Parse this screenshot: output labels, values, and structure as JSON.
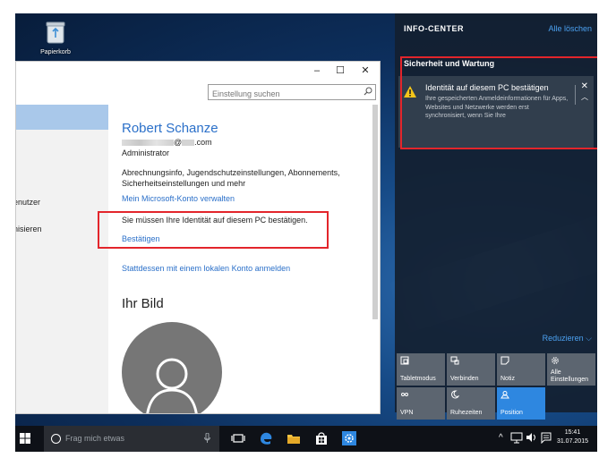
{
  "desktop": {
    "recycle_bin_label": "Papierkorb"
  },
  "settings_window": {
    "controls": {
      "minimize": "–",
      "maximize": "☐",
      "close": "✕"
    },
    "search": {
      "placeholder": "Einstellung suchen"
    },
    "nav_items": [
      "enutzer",
      "nisieren"
    ],
    "account": {
      "name": "Robert Schanze",
      "email_at": "@",
      "email_domain": ".com",
      "role": "Administrator",
      "billing_text": "Abrechnungsinfo, Jugendschutzeinstellungen, Abonnements, Sicherheitseinstellungen und mehr",
      "manage_link": "Mein Microsoft-Konto verwalten",
      "verify_text": "Sie müssen Ihre Identität auf diesem PC bestätigen.",
      "confirm_link": "Bestätigen",
      "local_link": "Stattdessen mit einem lokalen Konto anmelden",
      "picture_heading": "Ihr Bild"
    }
  },
  "action_center": {
    "title": "INFO-CENTER",
    "clear_all": "Alle löschen",
    "group_title": "Sicherheit und Wartung",
    "notification": {
      "title": "Identität auf diesem PC bestätigen",
      "body": "Ihre gespeicherten Anmeldeinformationen für Apps, Websites und Netzwerke werden erst synchronisiert, wenn Sie Ihre",
      "close": "✕",
      "expand": "︿"
    },
    "reduce_label": "Reduzieren",
    "tiles": [
      {
        "label": "Tabletmodus",
        "icon": "tablet-icon",
        "active": false
      },
      {
        "label": "Verbinden",
        "icon": "connect-icon",
        "active": false
      },
      {
        "label": "Notiz",
        "icon": "note-icon",
        "active": false
      },
      {
        "label": "Alle Einstellungen",
        "icon": "gear-icon",
        "active": false
      },
      {
        "label": "VPN",
        "icon": "vpn-icon",
        "active": false
      },
      {
        "label": "Ruhezeiten",
        "icon": "moon-icon",
        "active": false
      },
      {
        "label": "Position",
        "icon": "location-icon",
        "active": true
      }
    ],
    "accent_color": "#2e87e0"
  },
  "taskbar": {
    "search_placeholder": "Frag mich etwas",
    "time": "15:41",
    "date": "31.07.2015"
  }
}
